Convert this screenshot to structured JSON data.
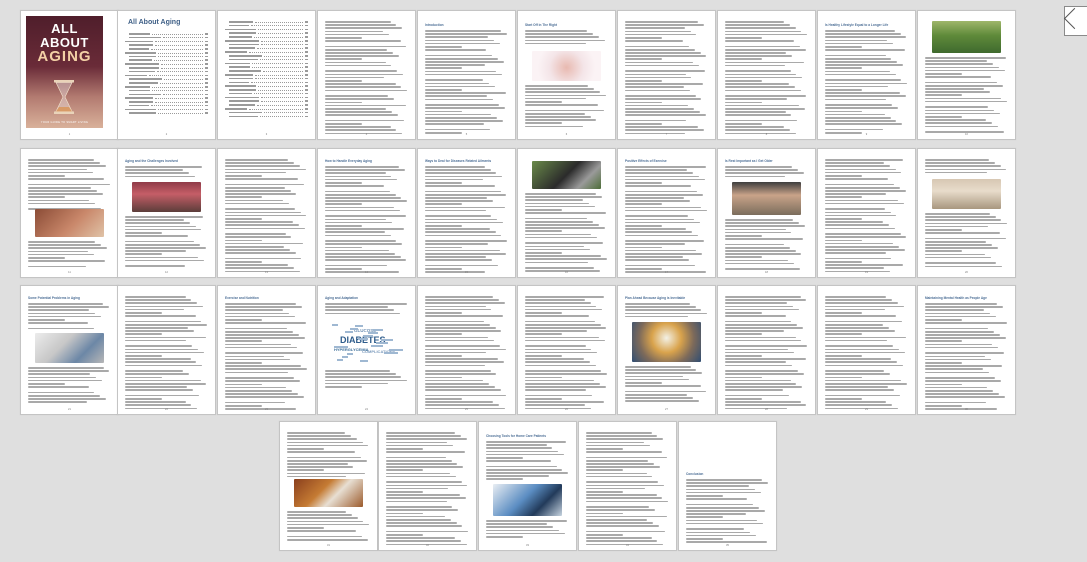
{
  "document": {
    "title": "All About Aging",
    "cover": {
      "line1": "ALL",
      "line2": "ABOUT",
      "line3": "AGING",
      "subtitle": "YOUR GUIDE TO SMART LIVING"
    },
    "page_headings": {
      "p05": "Introduction",
      "p06": "Start Off in The Right",
      "p08": "Something to Consider",
      "p10": "Is Healthy Lifestyle Equal to a Longer Life",
      "p13": "Aging and the Challenges Involved",
      "p15": "How to Handle Everyday Aging",
      "p16": "Ways to Deal for Diseases Related Ailments",
      "p17": "Positive Effects of Exercise",
      "p18": "Is Rest Important as I Get Older",
      "p21": "Some Potential Problems in Aging",
      "p23": "Exercise and Nutrition",
      "p24": "Aging and Adaptation",
      "p27": "Plan Ahead Because Aging is Inevitable",
      "p29": "Maintaining Mental Health as People Age",
      "p32": "Choosing Tools for Home Care Patients",
      "p35": "Conclusion"
    },
    "word_cloud": [
      "DIABETES",
      "GLUCOSE",
      "HYPERGLYCEMIA",
      "COMPLICATIONS"
    ],
    "page_numbers": [
      "1",
      "2",
      "3",
      "4",
      "5",
      "6",
      "7",
      "8",
      "9",
      "10",
      "11",
      "12",
      "13",
      "14",
      "15",
      "16",
      "17",
      "18",
      "19",
      "20",
      "21",
      "22",
      "23",
      "24",
      "25",
      "26",
      "27",
      "28",
      "29",
      "30",
      "31",
      "32",
      "33",
      "34",
      "35"
    ]
  }
}
